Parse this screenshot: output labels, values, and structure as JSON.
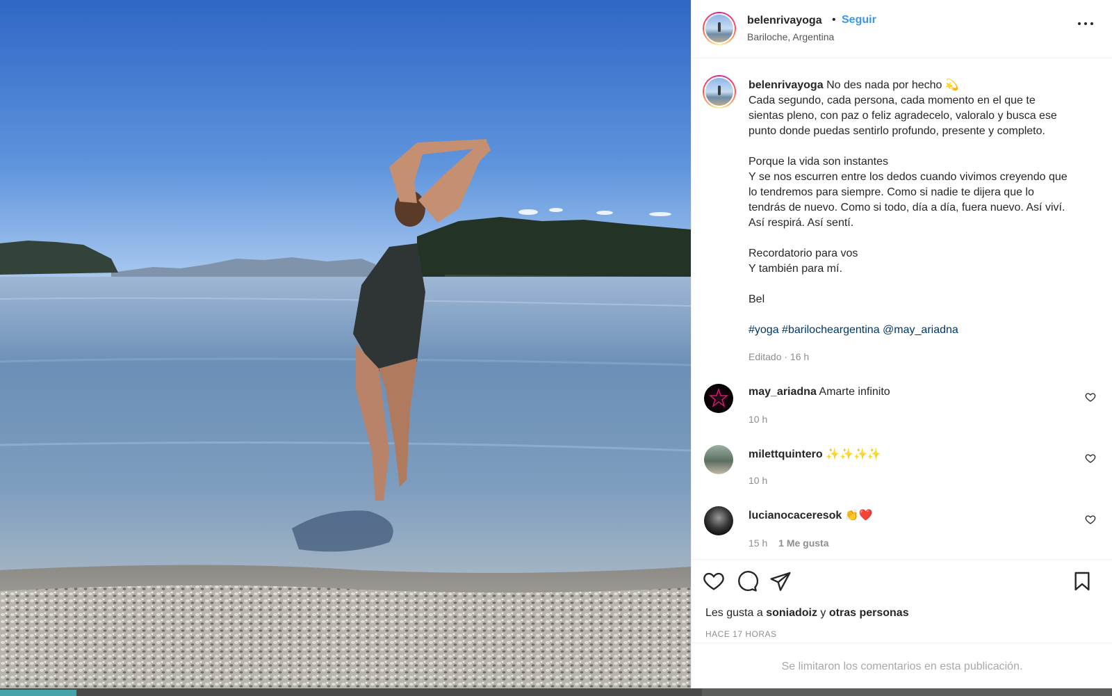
{
  "post": {
    "username": "belenrivayoga",
    "separator": "•",
    "follow_label": "Seguir",
    "location": "Bariloche, Argentina",
    "more_icon": "more-options-icon"
  },
  "caption": {
    "username": "belenrivayoga",
    "first_line": "No des nada por hecho",
    "first_emoji": "💫",
    "lines_block1": [
      "Cada segundo, cada persona, cada momento en el que te",
      "sientas pleno, con paz o feliz agradecelo, valoralo y busca ese",
      "punto donde puedas sentirlo profundo, presente y completo."
    ],
    "lines_block2": [
      "Porque la vida son instantes",
      "Y se nos escurren entre los dedos cuando vivimos creyendo que",
      "lo tendremos para siempre. Como si nadie te dijera que lo",
      "tendrás de nuevo. Como si todo, día a día, fuera nuevo. Así viví.",
      "Así respirá. Así sentí."
    ],
    "lines_block3": [
      "Recordatorio para vos",
      "Y también para mí."
    ],
    "signature": "Bel",
    "tags": [
      "#yoga",
      "#barilocheargentina",
      "@may_ariadna"
    ],
    "meta": "Editado · 16 h"
  },
  "comments": [
    {
      "username": "may_ariadna",
      "text": "Amarte infinito",
      "time": "10 h",
      "likes": ""
    },
    {
      "username": "milettquintero",
      "text": "✨✨✨✨",
      "time": "10 h",
      "likes": ""
    },
    {
      "username": "lucianocaceresok",
      "text": "👏❤️",
      "time": "15 h",
      "likes": "1 Me gusta"
    }
  ],
  "actions": {
    "like_icon": "heart-icon",
    "comment_icon": "comment-icon",
    "share_icon": "send-icon",
    "save_icon": "bookmark-icon"
  },
  "likes": {
    "prefix": "Les gusta a",
    "user": "soniadoiz",
    "connector": "y",
    "others": "otras personas"
  },
  "posted_ago": "HACE 17 HORAS",
  "comments_limited": "Se limitaron los comentarios en esta publicación.",
  "colors": {
    "link_blue": "#3897f0",
    "hashtag_blue": "#00376b",
    "muted_gray": "#8e8e8e"
  }
}
